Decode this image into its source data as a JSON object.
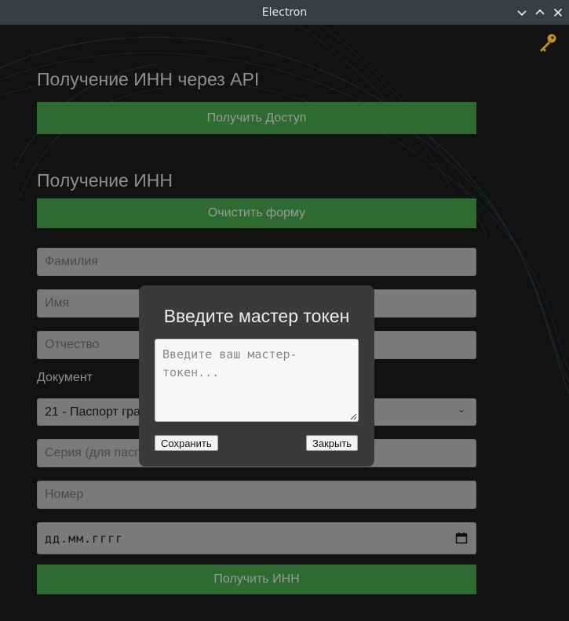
{
  "window": {
    "title": "Electron"
  },
  "icons": {
    "minimize": "chevron-down-icon",
    "maximize": "chevron-up-icon",
    "close": "close-icon",
    "key": "key-icon",
    "calendar": "calendar-icon"
  },
  "colors": {
    "accent_green": "#2e6b31",
    "background": "#121212",
    "modal": "#3a3a3a"
  },
  "api_section": {
    "heading": "Получение ИНН через API",
    "access_button": "Получить Доступ"
  },
  "inn_section": {
    "heading": "Получение ИНН",
    "clear_button": "Очистить форму",
    "surname_placeholder": "Фамилия",
    "name_placeholder": "Имя",
    "patronymic_placeholder": "Отчество",
    "document_label": "Документ",
    "document_selected": "21 - Паспорт гра",
    "series_placeholder": "Серия (для пасп",
    "number_placeholder": "Номер",
    "date_placeholder": "дд.мм.гггг",
    "submit_button": "Получить ИНН"
  },
  "modal": {
    "title": "Введите мастер токен",
    "textarea_placeholder": "Введите ваш мастер-\nтокен...",
    "save_button": "Сохранить",
    "close_button": "Закрыть"
  }
}
